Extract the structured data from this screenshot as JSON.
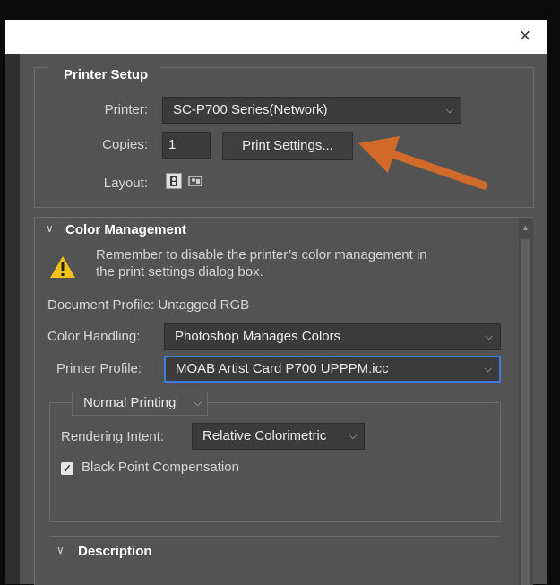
{
  "window": {
    "close_glyph": "×"
  },
  "printer_setup": {
    "title": "Printer Setup",
    "printer_label": "Printer:",
    "printer_value": "SC-P700 Series(Network)",
    "copies_label": "Copies:",
    "copies_value": "1",
    "print_settings_button": "Print Settings...",
    "layout_label": "Layout:"
  },
  "color_management": {
    "title": "Color Management",
    "warning": "Remember to disable the printer’s color management in the print settings dialog box.",
    "document_profile": "Document Profile: Untagged RGB",
    "color_handling_label": "Color Handling:",
    "color_handling_value": "Photoshop Manages Colors",
    "printer_profile_label": "Printer Profile:",
    "printer_profile_value": "MOAB Artist Card P700 UPPPM.icc",
    "printing_mode": "Normal Printing",
    "rendering_intent_label": "Rendering Intent:",
    "rendering_intent_value": "Relative Colorimetric",
    "black_point_label": "Black Point Compensation",
    "black_point_checked": true
  },
  "description": {
    "title": "Description"
  },
  "colors": {
    "accent_arrow": "#d26a2a",
    "focus_blue": "#3d7fd8",
    "warning_yellow": "#f2c21b"
  }
}
